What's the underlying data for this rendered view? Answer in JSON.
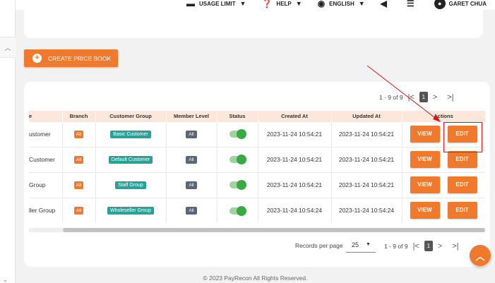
{
  "topnav": {
    "usage_label": "USAGE LIMIT",
    "help_label": "HELP",
    "language_label": "ENGLISH",
    "user_name": "GARET CHUA"
  },
  "create_button": {
    "label": "CREATE PRICE BOOK"
  },
  "pager_top": {
    "range": "1 - 9 of 9",
    "current": "1"
  },
  "table": {
    "headers": [
      "e",
      "Branch",
      "Customer Group",
      "Member Level",
      "Status",
      "Created At",
      "Updated At",
      "Actions"
    ],
    "rows": [
      {
        "name": "ustomer",
        "branch": "All",
        "group": "Basic Customer",
        "member": "All",
        "created": "2023-11-24 10:54:21",
        "updated": "2023-11-24 10:54:21"
      },
      {
        "name": "Customer",
        "branch": "All",
        "group": "Default Customer",
        "member": "All",
        "created": "2023-11-24 10:54:21",
        "updated": "2023-11-24 10:54:21"
      },
      {
        "name": "Group",
        "branch": "All",
        "group": "Staff Group",
        "member": "All",
        "created": "2023-11-24 10:54:21",
        "updated": "2023-11-24 10:54:21"
      },
      {
        "name": "ller Group",
        "branch": "All",
        "group": "Wholeseller Group",
        "member": "All",
        "created": "2023-11-24 10:54:24",
        "updated": "2023-11-24 10:54:24"
      }
    ],
    "view_label": "VIEW",
    "edit_label": "EDIT"
  },
  "pager_bottom": {
    "rpp_label": "Records per page",
    "rpp_value": "25",
    "range": "1 - 9 of 9",
    "current": "1"
  },
  "footer": {
    "text": "© 2023 PayRecon   All Rights Reserved."
  },
  "colors": {
    "accent": "#ef7a2d",
    "teal": "#2aa198",
    "toggle": "#3aa845",
    "annotation": "#e11111"
  }
}
